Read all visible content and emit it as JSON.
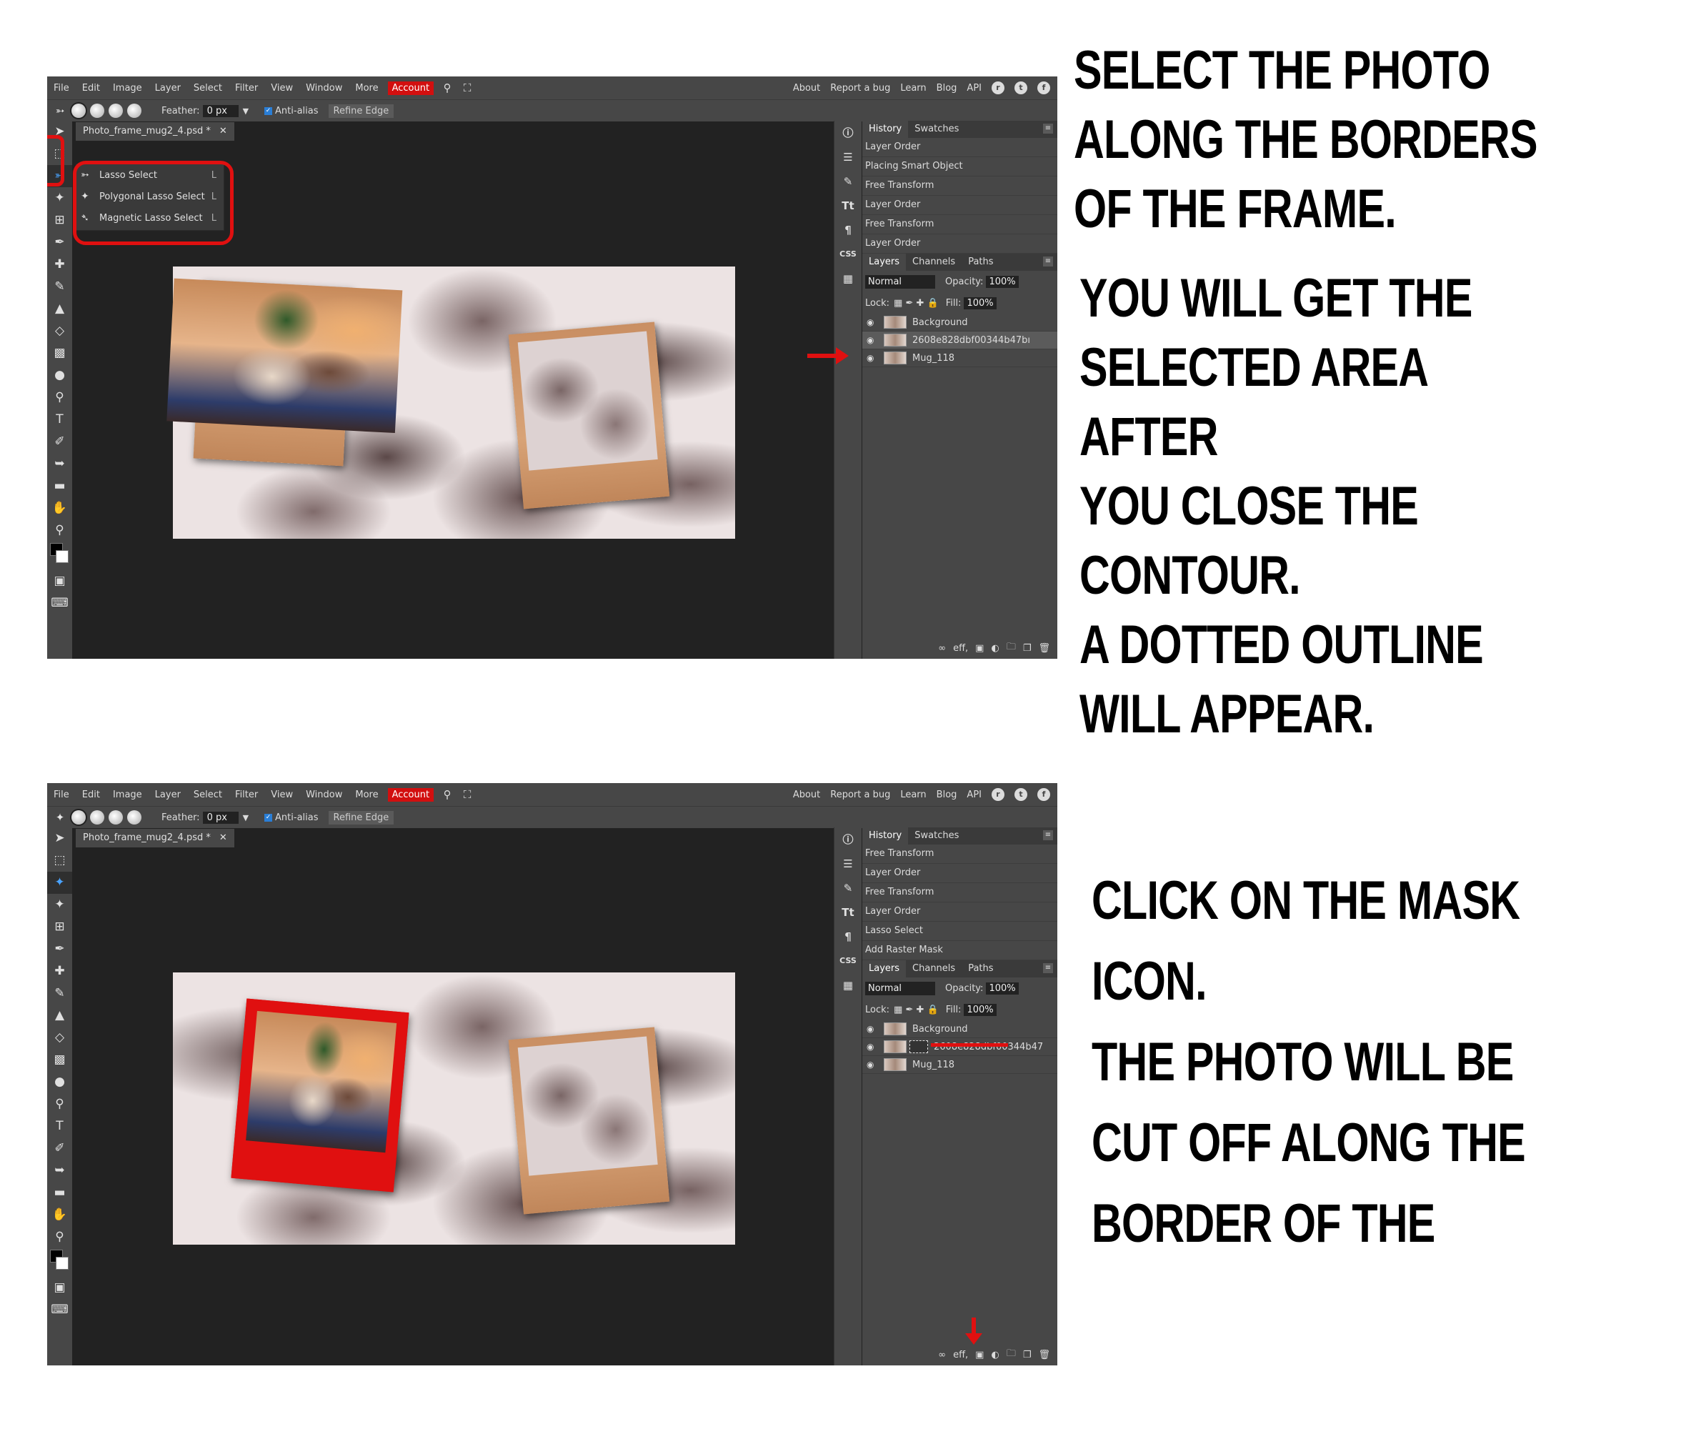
{
  "screens": [
    {
      "menu": {
        "items": [
          "File",
          "Edit",
          "Image",
          "Layer",
          "Select",
          "Filter",
          "View",
          "Window",
          "More"
        ],
        "account": "Account",
        "right_links": [
          "About",
          "Report a bug",
          "Learn",
          "Blog",
          "API"
        ]
      },
      "options": {
        "feather_label": "Feather:",
        "feather_value": "0 px",
        "antialias_label": "Anti-alias",
        "refine_label": "Refine Edge"
      },
      "doc_tab": "Photo_frame_mug2_4.psd *",
      "dropdown": [
        {
          "label": "Lasso Select",
          "key": "L"
        },
        {
          "label": "Polygonal Lasso Select",
          "key": "L"
        },
        {
          "label": "Magnetic Lasso Select",
          "key": "L"
        }
      ],
      "history_tabs": [
        "History",
        "Swatches"
      ],
      "history": [
        "Layer Order",
        "Placing Smart Object",
        "Free Transform",
        "Layer Order",
        "Free Transform",
        "Layer Order"
      ],
      "layer_tabs": [
        "Layers",
        "Channels",
        "Paths"
      ],
      "blend": "Normal",
      "opacity_label": "Opacity:",
      "opacity": "100%",
      "lock_label": "Lock:",
      "fill_label": "Fill:",
      "fill": "100%",
      "layers": [
        "Background",
        "2608e828dbf00344b47bı",
        "Mug_118"
      ],
      "footer": "eff,"
    },
    {
      "menu": {
        "items": [
          "File",
          "Edit",
          "Image",
          "Layer",
          "Select",
          "Filter",
          "View",
          "Window",
          "More"
        ],
        "account": "Account",
        "right_links": [
          "About",
          "Report a bug",
          "Learn",
          "Blog",
          "API"
        ]
      },
      "options": {
        "feather_label": "Feather:",
        "feather_value": "0 px",
        "antialias_label": "Anti-alias",
        "refine_label": "Refine Edge"
      },
      "doc_tab": "Photo_frame_mug2_4.psd *",
      "history_tabs": [
        "History",
        "Swatches"
      ],
      "history": [
        "Free Transform",
        "Layer Order",
        "Free Transform",
        "Layer Order",
        "Lasso Select",
        "Add Raster Mask"
      ],
      "layer_tabs": [
        "Layers",
        "Channels",
        "Paths"
      ],
      "blend": "Normal",
      "opacity_label": "Opacity:",
      "opacity": "100%",
      "lock_label": "Lock:",
      "fill_label": "Fill:",
      "fill": "100%",
      "layers": [
        "Background",
        "2608e828dbf00344b47",
        "Mug_118"
      ],
      "footer": "eff,"
    }
  ],
  "instructions": [
    "SELECT THE PHOTO\nALONG THE BORDERS\nOF THE FRAME.",
    "YOU WILL GET THE\nSELECTED AREA AFTER\nYOU CLOSE THE\nCONTOUR.\n A DOTTED OUTLINE\nWILL APPEAR.",
    "CLICK ON THE MASK\nICON.\n THE PHOTO WILL BE\nCUT OFF ALONG THE\nBORDER OF THE"
  ],
  "colors": {
    "accent_red": "#e01010",
    "account_red": "#d20f0f",
    "panel_gray": "#474747",
    "workspace": "#222222"
  }
}
